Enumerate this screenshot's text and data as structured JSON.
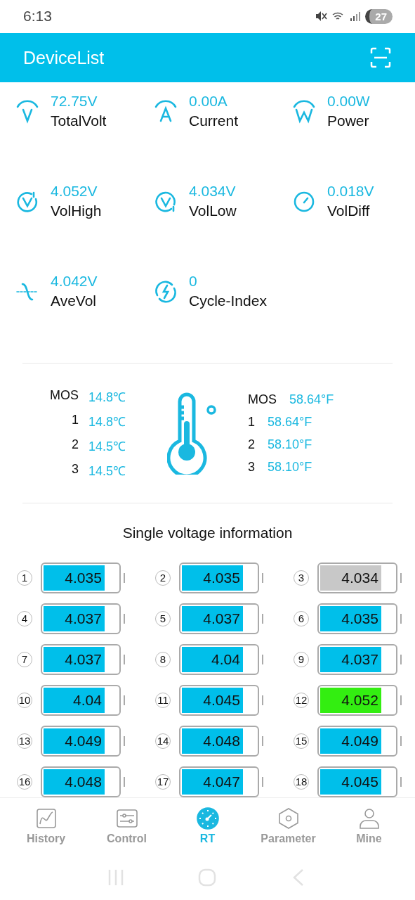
{
  "status_bar": {
    "time": "6:13",
    "battery": "27"
  },
  "header": {
    "title": "DeviceList"
  },
  "metrics": [
    {
      "value": "72.75V",
      "label": "TotalVolt"
    },
    {
      "value": "0.00A",
      "label": "Current"
    },
    {
      "value": "0.00W",
      "label": "Power"
    },
    {
      "value": "4.052V",
      "label": "VolHigh"
    },
    {
      "value": "4.034V",
      "label": "VolLow"
    },
    {
      "value": "0.018V",
      "label": "VolDiff"
    },
    {
      "value": "4.042V",
      "label": "AveVol"
    },
    {
      "value": "0",
      "label": "Cycle-Index"
    }
  ],
  "temperatures_c": [
    {
      "label": "MOS",
      "value": "14.8℃"
    },
    {
      "label": "1",
      "value": "14.8℃"
    },
    {
      "label": "2",
      "value": "14.5℃"
    },
    {
      "label": "3",
      "value": "14.5℃"
    }
  ],
  "temperatures_f": [
    {
      "label": "MOS",
      "value": "58.64°F"
    },
    {
      "label": "1",
      "value": "58.64°F"
    },
    {
      "label": "2",
      "value": "58.10°F"
    },
    {
      "label": "3",
      "value": "58.10°F"
    }
  ],
  "cells_title": "Single voltage information",
  "cells": [
    {
      "index": "1",
      "voltage": "4.035",
      "level": 0.82,
      "color": "#00bfea"
    },
    {
      "index": "2",
      "voltage": "4.035",
      "level": 0.82,
      "color": "#00bfea"
    },
    {
      "index": "3",
      "voltage": "4.034",
      "level": 0.82,
      "color": "#c8c8c8"
    },
    {
      "index": "4",
      "voltage": "4.037",
      "level": 0.82,
      "color": "#00bfea"
    },
    {
      "index": "5",
      "voltage": "4.037",
      "level": 0.82,
      "color": "#00bfea"
    },
    {
      "index": "6",
      "voltage": "4.035",
      "level": 0.82,
      "color": "#00bfea"
    },
    {
      "index": "7",
      "voltage": "4.037",
      "level": 0.82,
      "color": "#00bfea"
    },
    {
      "index": "8",
      "voltage": "4.04",
      "level": 0.82,
      "color": "#00bfea"
    },
    {
      "index": "9",
      "voltage": "4.037",
      "level": 0.82,
      "color": "#00bfea"
    },
    {
      "index": "10",
      "voltage": "4.04",
      "level": 0.82,
      "color": "#00bfea"
    },
    {
      "index": "11",
      "voltage": "4.045",
      "level": 0.82,
      "color": "#00bfea"
    },
    {
      "index": "12",
      "voltage": "4.052",
      "level": 0.82,
      "color": "#33ee11"
    },
    {
      "index": "13",
      "voltage": "4.049",
      "level": 0.82,
      "color": "#00bfea"
    },
    {
      "index": "14",
      "voltage": "4.048",
      "level": 0.82,
      "color": "#00bfea"
    },
    {
      "index": "15",
      "voltage": "4.049",
      "level": 0.82,
      "color": "#00bfea"
    },
    {
      "index": "16",
      "voltage": "4.048",
      "level": 0.82,
      "color": "#00bfea"
    },
    {
      "index": "17",
      "voltage": "4.047",
      "level": 0.82,
      "color": "#00bfea"
    },
    {
      "index": "18",
      "voltage": "4.045",
      "level": 0.82,
      "color": "#00bfea"
    }
  ],
  "bottom_nav": [
    {
      "label": "History",
      "selected": false
    },
    {
      "label": "Control",
      "selected": false
    },
    {
      "label": "RT",
      "selected": true
    },
    {
      "label": "Parameter",
      "selected": false
    },
    {
      "label": "Mine",
      "selected": false
    }
  ]
}
